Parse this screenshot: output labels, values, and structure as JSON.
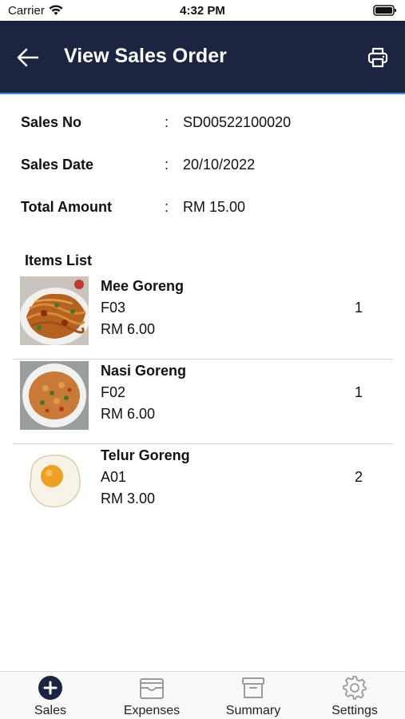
{
  "status_bar": {
    "carrier": "Carrier",
    "time": "4:32 PM"
  },
  "header": {
    "title": "View Sales Order",
    "background": "#1b2440"
  },
  "order": {
    "sales_no": {
      "label": "Sales No",
      "colon": ":",
      "value": "SD00522100020"
    },
    "sales_date": {
      "label": "Sales Date",
      "colon": ":",
      "value": "20/10/2022"
    },
    "total_amount": {
      "label": "Total Amount",
      "colon": ":",
      "value": "RM 15.00"
    }
  },
  "items_title": "Items List",
  "items": [
    {
      "name": "Mee Goreng",
      "code": "F03",
      "price": "RM 6.00",
      "qty": "1",
      "image": "mee-goreng-image"
    },
    {
      "name": "Nasi Goreng",
      "code": "F02",
      "price": "RM 6.00",
      "qty": "1",
      "image": "nasi-goreng-image"
    },
    {
      "name": "Telur Goreng",
      "code": "A01",
      "price": "RM 3.00",
      "qty": "2",
      "image": "fried-egg-image"
    }
  ],
  "tabs": [
    {
      "label": "Sales",
      "icon": "plus-circle-icon",
      "active": true
    },
    {
      "label": "Expenses",
      "icon": "wallet-icon",
      "active": false
    },
    {
      "label": "Summary",
      "icon": "archive-box-icon",
      "active": false
    },
    {
      "label": "Settings",
      "icon": "gear-icon",
      "active": false
    }
  ],
  "colors": {
    "header": "#1b2440",
    "accent_line": "#3a8fe0",
    "active_tab": "#1b2440",
    "inactive_tab": "#9a9a9a"
  }
}
